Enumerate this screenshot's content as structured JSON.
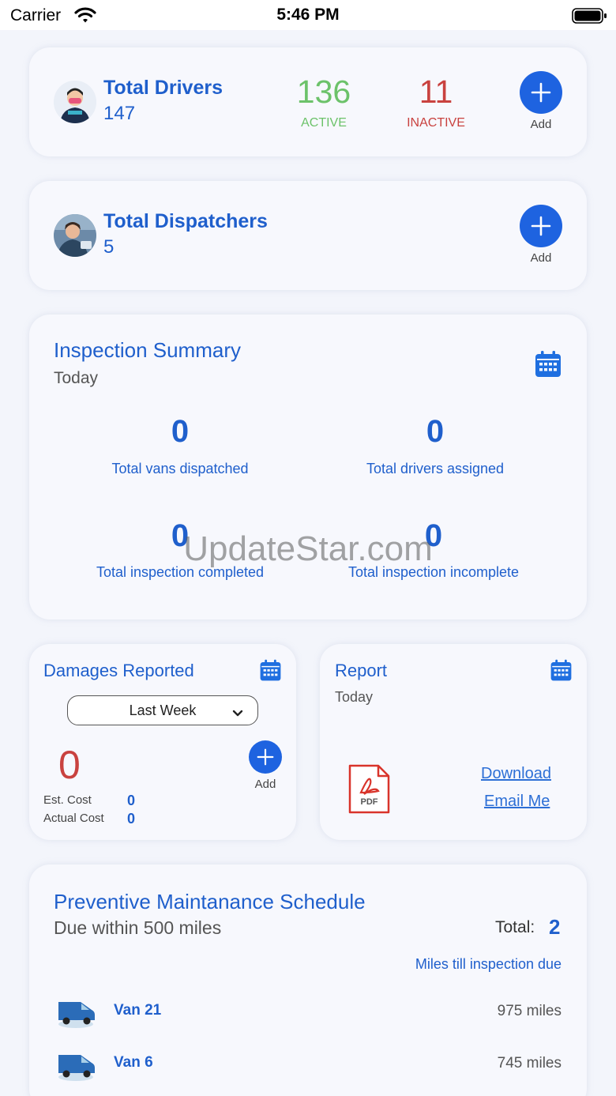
{
  "status_bar": {
    "carrier": "Carrier",
    "time": "5:46 PM"
  },
  "drivers": {
    "title": "Total Drivers",
    "total": "147",
    "active_value": "136",
    "active_label": "ACTIVE",
    "inactive_value": "11",
    "inactive_label": "INACTIVE",
    "add_label": "Add"
  },
  "dispatchers": {
    "title": "Total Dispatchers",
    "total": "5",
    "add_label": "Add"
  },
  "inspection": {
    "title": "Inspection Summary",
    "period": "Today",
    "stats": [
      {
        "value": "0",
        "label": "Total vans dispatched"
      },
      {
        "value": "0",
        "label": "Total drivers assigned"
      },
      {
        "value": "0",
        "label": "Total inspection completed"
      },
      {
        "value": "0",
        "label": "Total inspection incomplete"
      }
    ]
  },
  "damages": {
    "title": "Damages Reported",
    "range": "Last Week",
    "count": "0",
    "est_cost_label": "Est. Cost",
    "est_cost_value": "0",
    "actual_cost_label": "Actual Cost",
    "actual_cost_value": "0",
    "add_label": "Add"
  },
  "report": {
    "title": "Report",
    "period": "Today",
    "pdf_label": "PDF",
    "download": "Download",
    "email": "Email Me"
  },
  "maintenance": {
    "title": "Preventive Maintanance Schedule",
    "subtitle": "Due within 500 miles",
    "total_label": "Total:",
    "total_value": "2",
    "column_label": "Miles till inspection due",
    "vans": [
      {
        "name": "Van 21",
        "miles": "975 miles"
      },
      {
        "name": "Van 6",
        "miles": "745 miles"
      }
    ]
  },
  "watermark": "UpdateStar.com",
  "colors": {
    "accent": "#1f5fcc",
    "active": "#6cc26a",
    "inactive": "#c9423f",
    "button": "#1e63e0"
  }
}
